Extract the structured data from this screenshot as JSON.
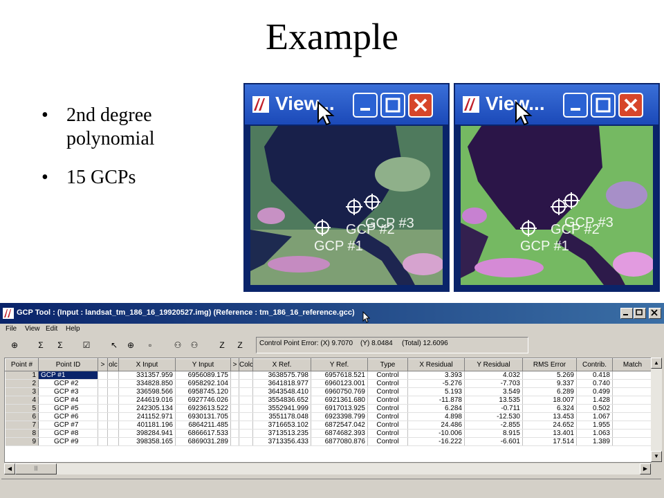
{
  "slide": {
    "title": "Example",
    "bullets": [
      "2nd degree polynomial",
      "15 GCPs"
    ]
  },
  "viewers": [
    {
      "title": "View...",
      "gcp_labels": [
        "GCP #1",
        "GCP #2",
        "GCP #3"
      ]
    },
    {
      "title": "View...",
      "gcp_labels": [
        "GCP #1",
        "GCP #2",
        "GCP #3"
      ]
    }
  ],
  "gcp_tool": {
    "title": "GCP Tool : (Input : landsat_tm_186_16_19920527.img) (Reference : tm_186_16_reference.gcc)",
    "menu": [
      "File",
      "View",
      "Edit",
      "Help"
    ],
    "control_point_error": {
      "x": "Control Point Error: (X) 9.7070",
      "y": "(Y) 8.0484",
      "total": "(Total) 12.6096"
    },
    "columns": [
      "Point #",
      "Point ID",
      ">",
      "olc",
      "X Input",
      "Y Input",
      ">",
      "Colc",
      "X Ref.",
      "Y Ref.",
      "Type",
      "X Residual",
      "Y Residual",
      "RMS Error",
      "Contrib.",
      "Match"
    ],
    "rows": [
      [
        "1",
        "GCP #1",
        "331357.959",
        "6956089.175",
        "3638575.798",
        "6957618.521",
        "Control",
        "3.393",
        "4.032",
        "5.269",
        "0.418"
      ],
      [
        "2",
        "GCP #2",
        "334828.850",
        "6958292.104",
        "3641818.977",
        "6960123.001",
        "Control",
        "-5.276",
        "-7.703",
        "9.337",
        "0.740"
      ],
      [
        "3",
        "GCP #3",
        "336598.566",
        "6958745.120",
        "3643548.410",
        "6960750.769",
        "Control",
        "5.193",
        "3.549",
        "6.289",
        "0.499"
      ],
      [
        "4",
        "GCP #4",
        "244619.016",
        "6927746.026",
        "3554836.652",
        "6921361.680",
        "Control",
        "-11.878",
        "13.535",
        "18.007",
        "1.428"
      ],
      [
        "5",
        "GCP #5",
        "242305.134",
        "6923613.522",
        "3552941.999",
        "6917013.925",
        "Control",
        "6.284",
        "-0.711",
        "6.324",
        "0.502"
      ],
      [
        "6",
        "GCP #6",
        "241152.971",
        "6930131.705",
        "3551178.048",
        "6923398.799",
        "Control",
        "4.898",
        "-12.530",
        "13.453",
        "1.067"
      ],
      [
        "7",
        "GCP #7",
        "401181.196",
        "6864211.485",
        "3716653.102",
        "6872547.042",
        "Control",
        "24.486",
        "-2.855",
        "24.652",
        "1.955"
      ],
      [
        "8",
        "GCP #8",
        "398284.941",
        "6866617.533",
        "3713513.235",
        "6874682.393",
        "Control",
        "-10.006",
        "8.915",
        "13.401",
        "1.063"
      ],
      [
        "9",
        "GCP #9",
        "398358.165",
        "6869031.289",
        "3713356.433",
        "6877080.876",
        "Control",
        "-16.222",
        "-6.601",
        "17.514",
        "1.389"
      ]
    ],
    "selected_row": 1,
    "colors": {
      "title_bar": "#0a246a",
      "window_bg": "#d4d0c8",
      "selection": "#0a246a"
    }
  }
}
